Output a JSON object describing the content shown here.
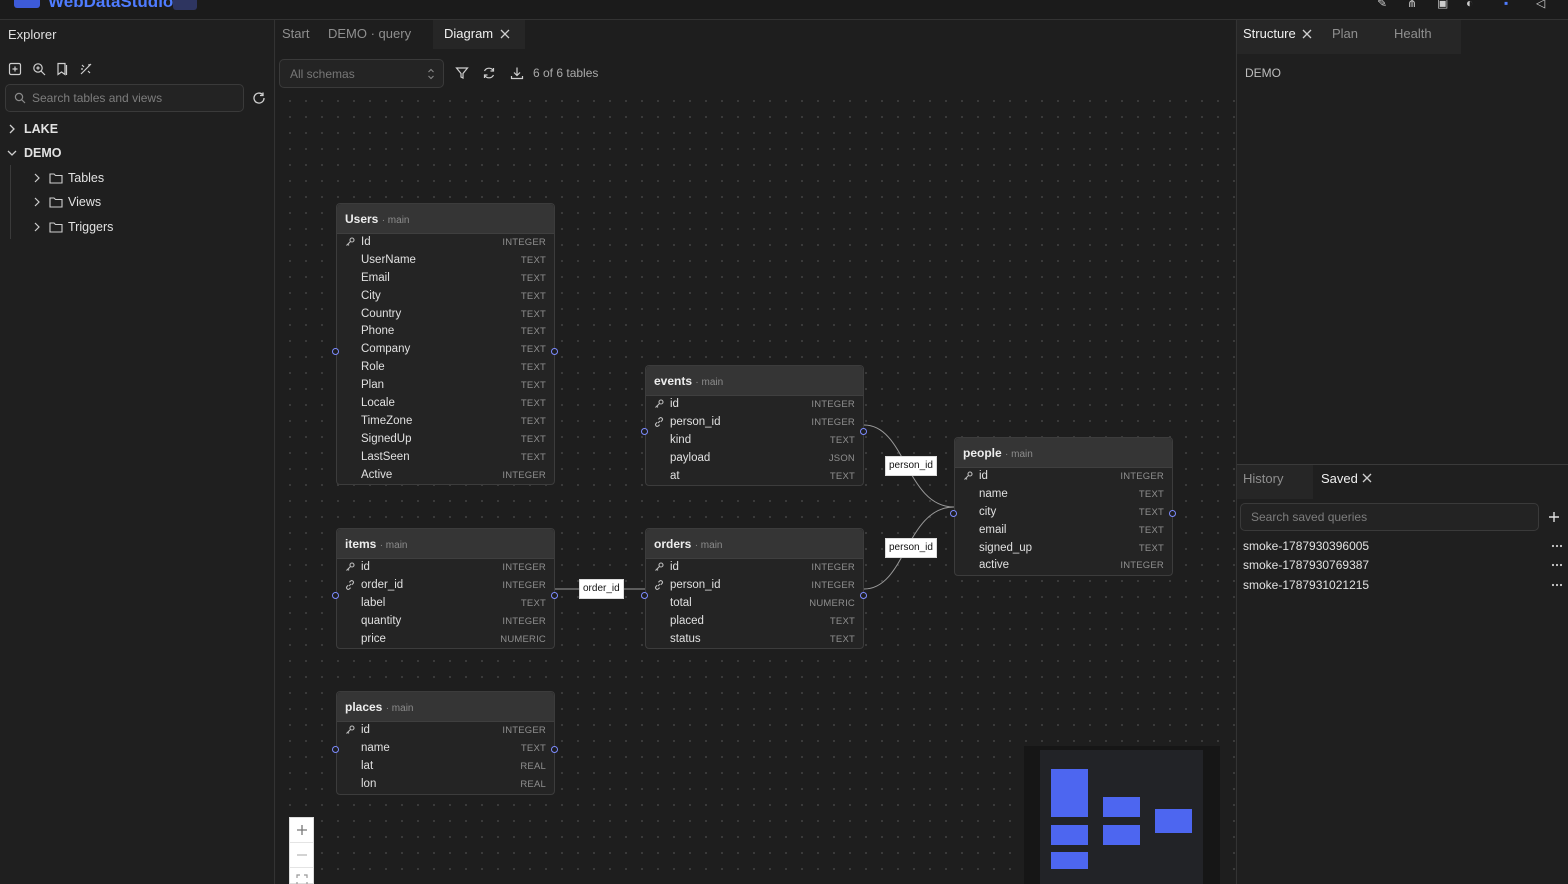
{
  "app": {
    "name": "WebDataStudio"
  },
  "explorer": {
    "title": "Explorer",
    "search_placeholder": "Search tables and views",
    "tree": [
      {
        "label": "LAKE",
        "expanded": false
      },
      {
        "label": "DEMO",
        "expanded": true,
        "children": [
          "Tables",
          "Views",
          "Triggers"
        ]
      }
    ]
  },
  "center": {
    "tabs": [
      "Start",
      "DEMO · query",
      "Diagram"
    ],
    "active_tab": "Diagram",
    "schema_select": "All schemas",
    "table_count": "6 of 6 tables"
  },
  "diagram": {
    "schema_label": "· main",
    "tables": [
      {
        "name": "Users",
        "columns": [
          [
            "Id",
            "INTEGER",
            "pk"
          ],
          [
            "UserName",
            "TEXT",
            ""
          ],
          [
            "Email",
            "TEXT",
            ""
          ],
          [
            "City",
            "TEXT",
            ""
          ],
          [
            "Country",
            "TEXT",
            ""
          ],
          [
            "Phone",
            "TEXT",
            ""
          ],
          [
            "Company",
            "TEXT",
            ""
          ],
          [
            "Role",
            "TEXT",
            ""
          ],
          [
            "Plan",
            "TEXT",
            ""
          ],
          [
            "Locale",
            "TEXT",
            ""
          ],
          [
            "TimeZone",
            "TEXT",
            ""
          ],
          [
            "SignedUp",
            "TEXT",
            ""
          ],
          [
            "LastSeen",
            "TEXT",
            ""
          ],
          [
            "Active",
            "INTEGER",
            ""
          ]
        ]
      },
      {
        "name": "events",
        "columns": [
          [
            "id",
            "INTEGER",
            "pk"
          ],
          [
            "person_id",
            "INTEGER",
            "fk"
          ],
          [
            "kind",
            "TEXT",
            ""
          ],
          [
            "payload",
            "JSON",
            ""
          ],
          [
            "at",
            "TEXT",
            ""
          ]
        ]
      },
      {
        "name": "people",
        "columns": [
          [
            "id",
            "INTEGER",
            "pk"
          ],
          [
            "name",
            "TEXT",
            ""
          ],
          [
            "city",
            "TEXT",
            ""
          ],
          [
            "email",
            "TEXT",
            ""
          ],
          [
            "signed_up",
            "TEXT",
            ""
          ],
          [
            "active",
            "INTEGER",
            ""
          ]
        ]
      },
      {
        "name": "items",
        "columns": [
          [
            "id",
            "INTEGER",
            "pk"
          ],
          [
            "order_id",
            "INTEGER",
            "fk"
          ],
          [
            "label",
            "TEXT",
            ""
          ],
          [
            "quantity",
            "INTEGER",
            ""
          ],
          [
            "price",
            "NUMERIC",
            ""
          ]
        ]
      },
      {
        "name": "orders",
        "columns": [
          [
            "id",
            "INTEGER",
            "pk"
          ],
          [
            "person_id",
            "INTEGER",
            "fk"
          ],
          [
            "total",
            "NUMERIC",
            ""
          ],
          [
            "placed",
            "TEXT",
            ""
          ],
          [
            "status",
            "TEXT",
            ""
          ]
        ]
      },
      {
        "name": "places",
        "columns": [
          [
            "id",
            "INTEGER",
            "pk"
          ],
          [
            "name",
            "TEXT",
            ""
          ],
          [
            "lat",
            "REAL",
            ""
          ],
          [
            "lon",
            "REAL",
            ""
          ]
        ]
      }
    ],
    "edge_labels": [
      "person_id",
      "person_id",
      "order_id"
    ]
  },
  "right": {
    "top_tabs": [
      "Structure",
      "Plan",
      "Health"
    ],
    "active_top_tab": "Structure",
    "structure_db": "DEMO",
    "bottom_tabs": [
      "History",
      "Saved"
    ],
    "active_bottom_tab": "Saved",
    "saved_search_placeholder": "Search saved queries",
    "saved_queries": [
      "smoke-1787930396005",
      "smoke-1787930769387",
      "smoke-1787931021215"
    ]
  },
  "colors": {
    "accent": "#4f7cff",
    "minimap_block": "#4d66f0"
  }
}
